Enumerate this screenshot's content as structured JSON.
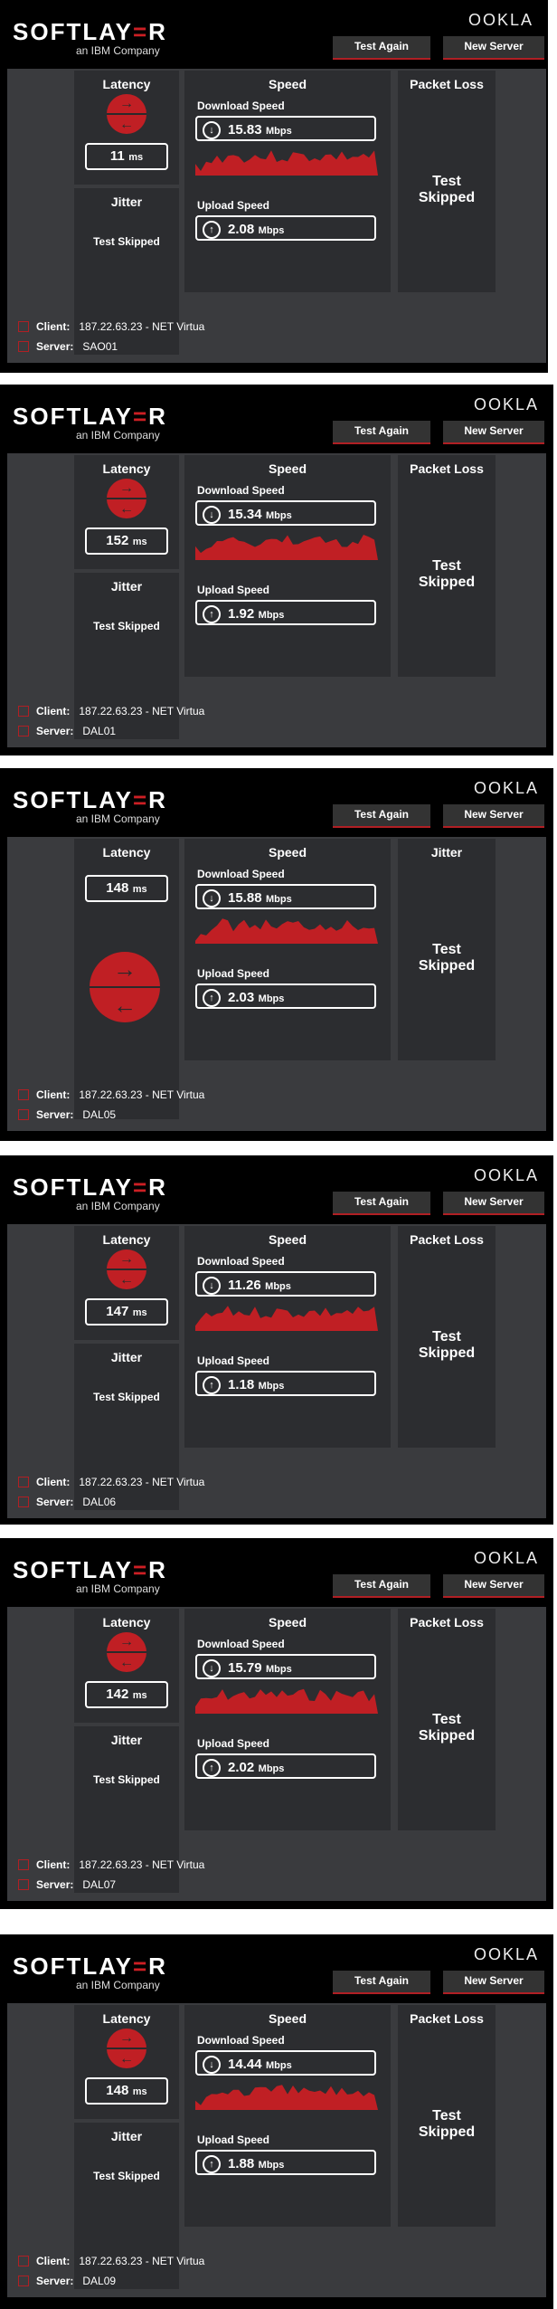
{
  "brand": {
    "main_left": "SOFTLAY",
    "main_accent": "=",
    "main_right": "R",
    "sub": "an IBM Company",
    "ookla": "OOKLA"
  },
  "buttons": {
    "test_again": "Test Again",
    "new_server": "New Server"
  },
  "labels": {
    "latency": "Latency",
    "speed": "Speed",
    "packet_loss": "Packet Loss",
    "jitter": "Jitter",
    "download_speed": "Download Speed",
    "upload_speed": "Upload Speed",
    "test_skipped": "Test Skipped",
    "test_skipped_l1": "Test",
    "test_skipped_l2": "Skipped",
    "client": "Client:",
    "server": "Server:",
    "ms": "ms",
    "mbps": "Mbps"
  },
  "colors": {
    "accent": "#c01f24",
    "panel_bg": "#000000",
    "dash_bg": "#3a3b3e",
    "col_bg": "#2c2d30"
  },
  "results": [
    {
      "latency": "11",
      "download": "15.83",
      "upload": "2.08",
      "client": "187.22.63.23 - NET Virtua",
      "server": "SAO01",
      "layout": "standard"
    },
    {
      "latency": "152",
      "download": "15.34",
      "upload": "1.92",
      "client": "187.22.63.23 - NET Virtua",
      "server": "DAL01",
      "layout": "standard"
    },
    {
      "latency": "148",
      "download": "15.88",
      "upload": "2.03",
      "client": "187.22.63.23 - NET Virtua",
      "server": "DAL05",
      "layout": "jitter-right"
    },
    {
      "latency": "147",
      "download": "11.26",
      "upload": "1.18",
      "client": "187.22.63.23 - NET Virtua",
      "server": "DAL06",
      "layout": "standard"
    },
    {
      "latency": "142",
      "download": "15.79",
      "upload": "2.02",
      "client": "187.22.63.23 - NET Virtua",
      "server": "DAL07",
      "layout": "standard"
    },
    {
      "latency": "148",
      "download": "14.44",
      "upload": "1.88",
      "client": "187.22.63.23 - NET Virtua",
      "server": "DAL09",
      "layout": "standard"
    }
  ]
}
